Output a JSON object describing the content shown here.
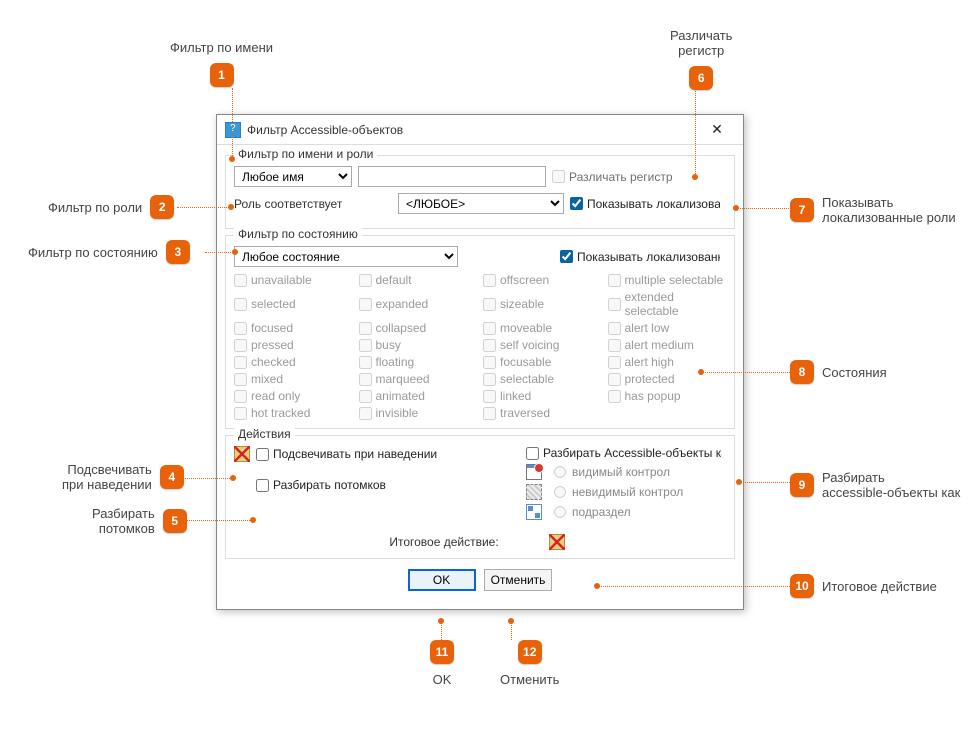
{
  "annotations": {
    "1": "Фильтр по имени",
    "2": "Фильтр по роли",
    "3": "Фильтр по состоянию",
    "4": "Подсвечивать при наведении",
    "5": "Разбирать потомков",
    "6": "Различать регистр",
    "7": "Показывать локализованные роли",
    "8": "Состояния",
    "9": "Разбирать accessible-объекты как",
    "10": "Итоговое действие",
    "11": "OK",
    "12": "Отменить"
  },
  "dialog": {
    "title": "Фильтр Accessible-объектов",
    "group_name_role": "Фильтр по имени и роли",
    "name_select": "Любое имя",
    "name_input": "",
    "case_label": "Различать регистр",
    "role_label": "Роль соответствует",
    "role_select": "<ЛЮБОЕ>",
    "show_localized_roles": "Показывать локализованн",
    "group_state": "Фильтр по состоянию",
    "state_select": "Любое состояние",
    "show_localized_states": "Показывать локализованны",
    "states_col1": [
      "unavailable",
      "selected",
      "focused",
      "pressed",
      "checked",
      "mixed",
      "read only",
      "hot tracked"
    ],
    "states_col2": [
      "default",
      "expanded",
      "collapsed",
      "busy",
      "floating",
      "marqueed",
      "animated",
      "invisible"
    ],
    "states_col3": [
      "offscreen",
      "sizeable",
      "moveable",
      "self voicing",
      "focusable",
      "selectable",
      "linked",
      "traversed"
    ],
    "states_col4": [
      "multiple selectable",
      "extended selectable",
      "alert low",
      "alert medium",
      "alert high",
      "protected",
      "has popup"
    ],
    "group_actions": "Действия",
    "highlight_label": "Подсвечивать при наведении",
    "parse_children_label": "Разбирать потомков",
    "parse_as_label": "Разбирать Accessible-объекты ка",
    "radio_visible": "видимый контрол",
    "radio_invisible": "невидимый контрол",
    "radio_subsection": "подраздел",
    "final_action_label": "Итоговое действие:",
    "ok": "OK",
    "cancel": "Отменить"
  }
}
